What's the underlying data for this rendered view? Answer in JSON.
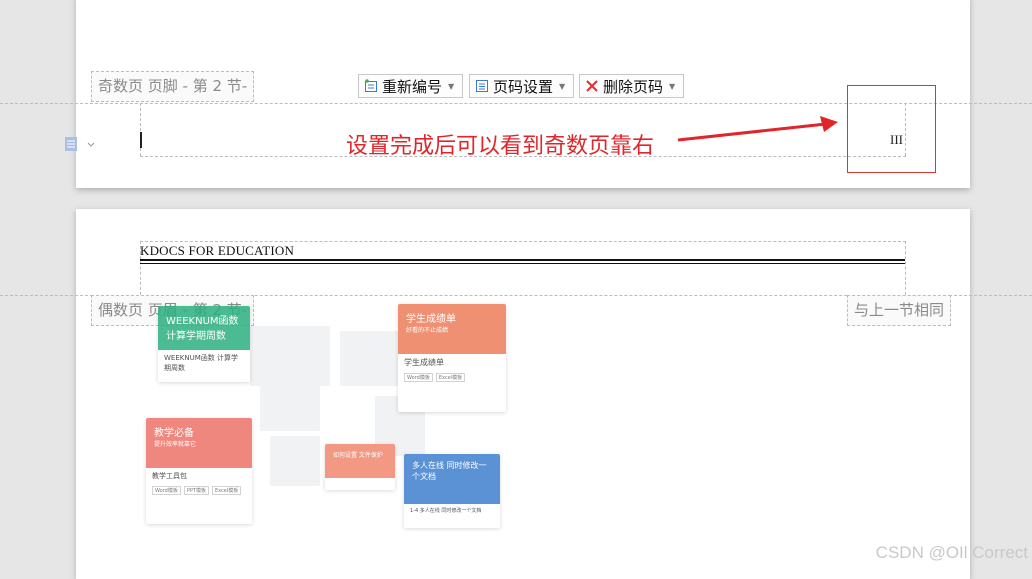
{
  "page1": {
    "footer_tab": "奇数页 页脚  - 第 2 节-",
    "toolbar": {
      "renumber_label": "重新编号",
      "page_setup_label": "页码设置",
      "delete_label": "删除页码"
    },
    "annotation": "设置完成后可以看到奇数页靠右",
    "page_number": "III"
  },
  "page2": {
    "header_text": "KDOCS FOR EDUCATION",
    "header_tab": "偶数页 页眉  - 第 2 节-",
    "same_as_previous": "与上一节相同",
    "collage": {
      "card_weeknum_banner": "WEEKNUM函数 计算学期周数",
      "card_weeknum_title": "WEEKNUM函数 计算学期周数",
      "card_grades_banner": "学生成绩单",
      "card_grades_sub": "好看的不止成绩",
      "card_grades_title": "学生成绩单",
      "tag_word": "Word模板",
      "tag_excel": "Excel模板",
      "tag_ppt": "PPT模板",
      "card_teach_banner": "教学必备",
      "card_teach_sub": "提升效率就靠它",
      "card_teach_title": "教学工具包",
      "card_protect_banner": "如何设置 文件保护",
      "card_online_banner": "多人在线 同时修改一个文档",
      "card_online_title": "1-4 多人在线 同时修改一个文档"
    }
  },
  "watermark": "CSDN @OIl Correct",
  "colors": {
    "annotation": "#e0262a",
    "arrow": "#e0262a",
    "section_tab_text": "#8a8a8a"
  }
}
